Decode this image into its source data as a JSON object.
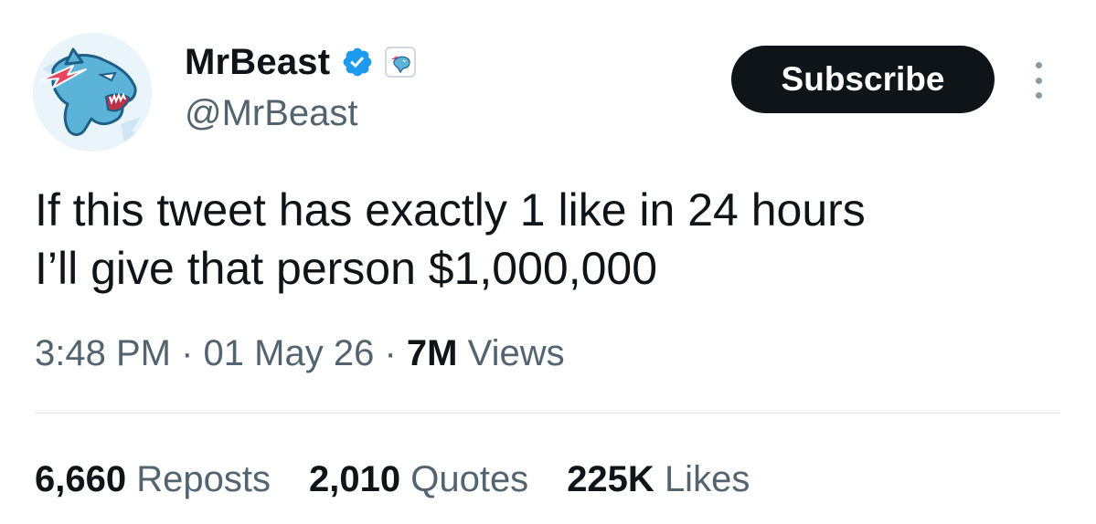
{
  "author": {
    "display_name": "MrBeast",
    "handle": "@MrBeast",
    "verified": true
  },
  "subscribe_label": "Subscribe",
  "tweet": {
    "lines": [
      "If this tweet has exactly 1 like in 24 hours",
      "I’ll give that person $1,000,000"
    ]
  },
  "meta": {
    "time": "3:48 PM",
    "sep": "·",
    "date": "01 May 26",
    "views_count": "7M",
    "views_label": "Views"
  },
  "stats": {
    "reposts_count": "6,660",
    "reposts_label": "Reposts",
    "quotes_count": "2,010",
    "quotes_label": "Quotes",
    "likes_count": "225K",
    "likes_label": "Likes"
  },
  "icons": {
    "verified": "verified-badge-icon",
    "affiliate": "affiliate-badge-icon",
    "more": "more-options-icon"
  },
  "colors": {
    "text": "#0f1419",
    "secondary": "#536471",
    "verified_blue": "#1d9bf0",
    "button_bg": "#0f1419",
    "avatar_panther": "#5bb4d8",
    "avatar_bolt": "#e8455f"
  }
}
